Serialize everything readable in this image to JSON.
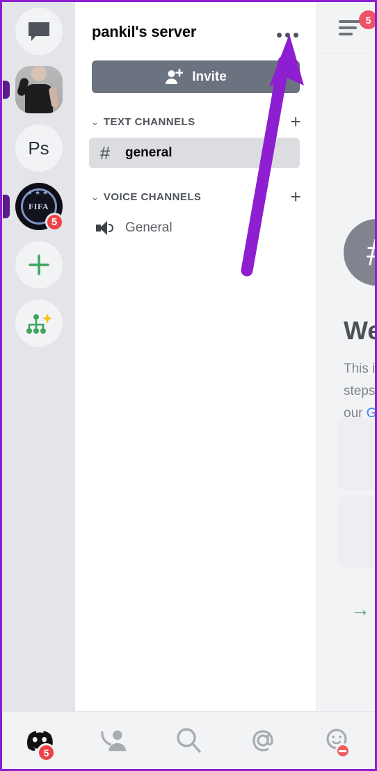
{
  "annotation": {
    "arrow_color": "#8d1fd1",
    "border_color": "#8d1fd1",
    "points_to": "server-options-more-button"
  },
  "server_rail": {
    "items": [
      {
        "name": "direct-messages",
        "type": "dm-icon",
        "label": "",
        "badge": ""
      },
      {
        "name": "server-avatar-photo",
        "type": "photo",
        "label": "",
        "badge": ""
      },
      {
        "name": "server-avatar-ps",
        "type": "text",
        "label": "Ps",
        "badge": ""
      },
      {
        "name": "server-avatar-fifa",
        "type": "crest",
        "label": "FIFA",
        "badge": "5"
      },
      {
        "name": "add-server",
        "type": "plus",
        "label": "+",
        "badge": ""
      },
      {
        "name": "explore-servers",
        "type": "explore",
        "label": "",
        "badge": ""
      }
    ]
  },
  "panel": {
    "server_name": "pankil's server",
    "more_label": "•••",
    "invite_label": "Invite",
    "categories": [
      {
        "label": "TEXT CHANNELS",
        "chevron": "⌄",
        "add": "+",
        "channels": [
          {
            "prefix": "#",
            "name": "general",
            "selected": true,
            "kind": "text"
          }
        ]
      },
      {
        "label": "VOICE CHANNELS",
        "chevron": "⌄",
        "add": "+",
        "channels": [
          {
            "prefix": "",
            "name": "General",
            "selected": false,
            "kind": "voice"
          }
        ]
      }
    ]
  },
  "peek": {
    "menu_badge": "5",
    "channel_avatar": "#",
    "welcome_heading": "We",
    "body_lines": [
      "This i",
      "steps",
      "our "
    ],
    "body_link": "G",
    "arrow": "→"
  },
  "bottom_nav": {
    "items": [
      {
        "name": "nav-home",
        "icon": "discord-logo-icon",
        "badge": "5"
      },
      {
        "name": "nav-friends",
        "icon": "friends-icon",
        "badge": ""
      },
      {
        "name": "nav-search",
        "icon": "search-icon",
        "badge": ""
      },
      {
        "name": "nav-mentions",
        "icon": "mention-icon",
        "badge": ""
      },
      {
        "name": "nav-profile",
        "icon": "profile-smiley-icon",
        "badge": "dnd"
      }
    ]
  },
  "colors": {
    "rail_bg": "#e3e5e8",
    "panel_bg": "#ffffff",
    "selected_channel_bg": "#dcdde1",
    "invite_bg": "#6b7280",
    "badge_red": "#ed4245",
    "accent_purple": "#8d1fd1",
    "green": "#3ba55d"
  }
}
